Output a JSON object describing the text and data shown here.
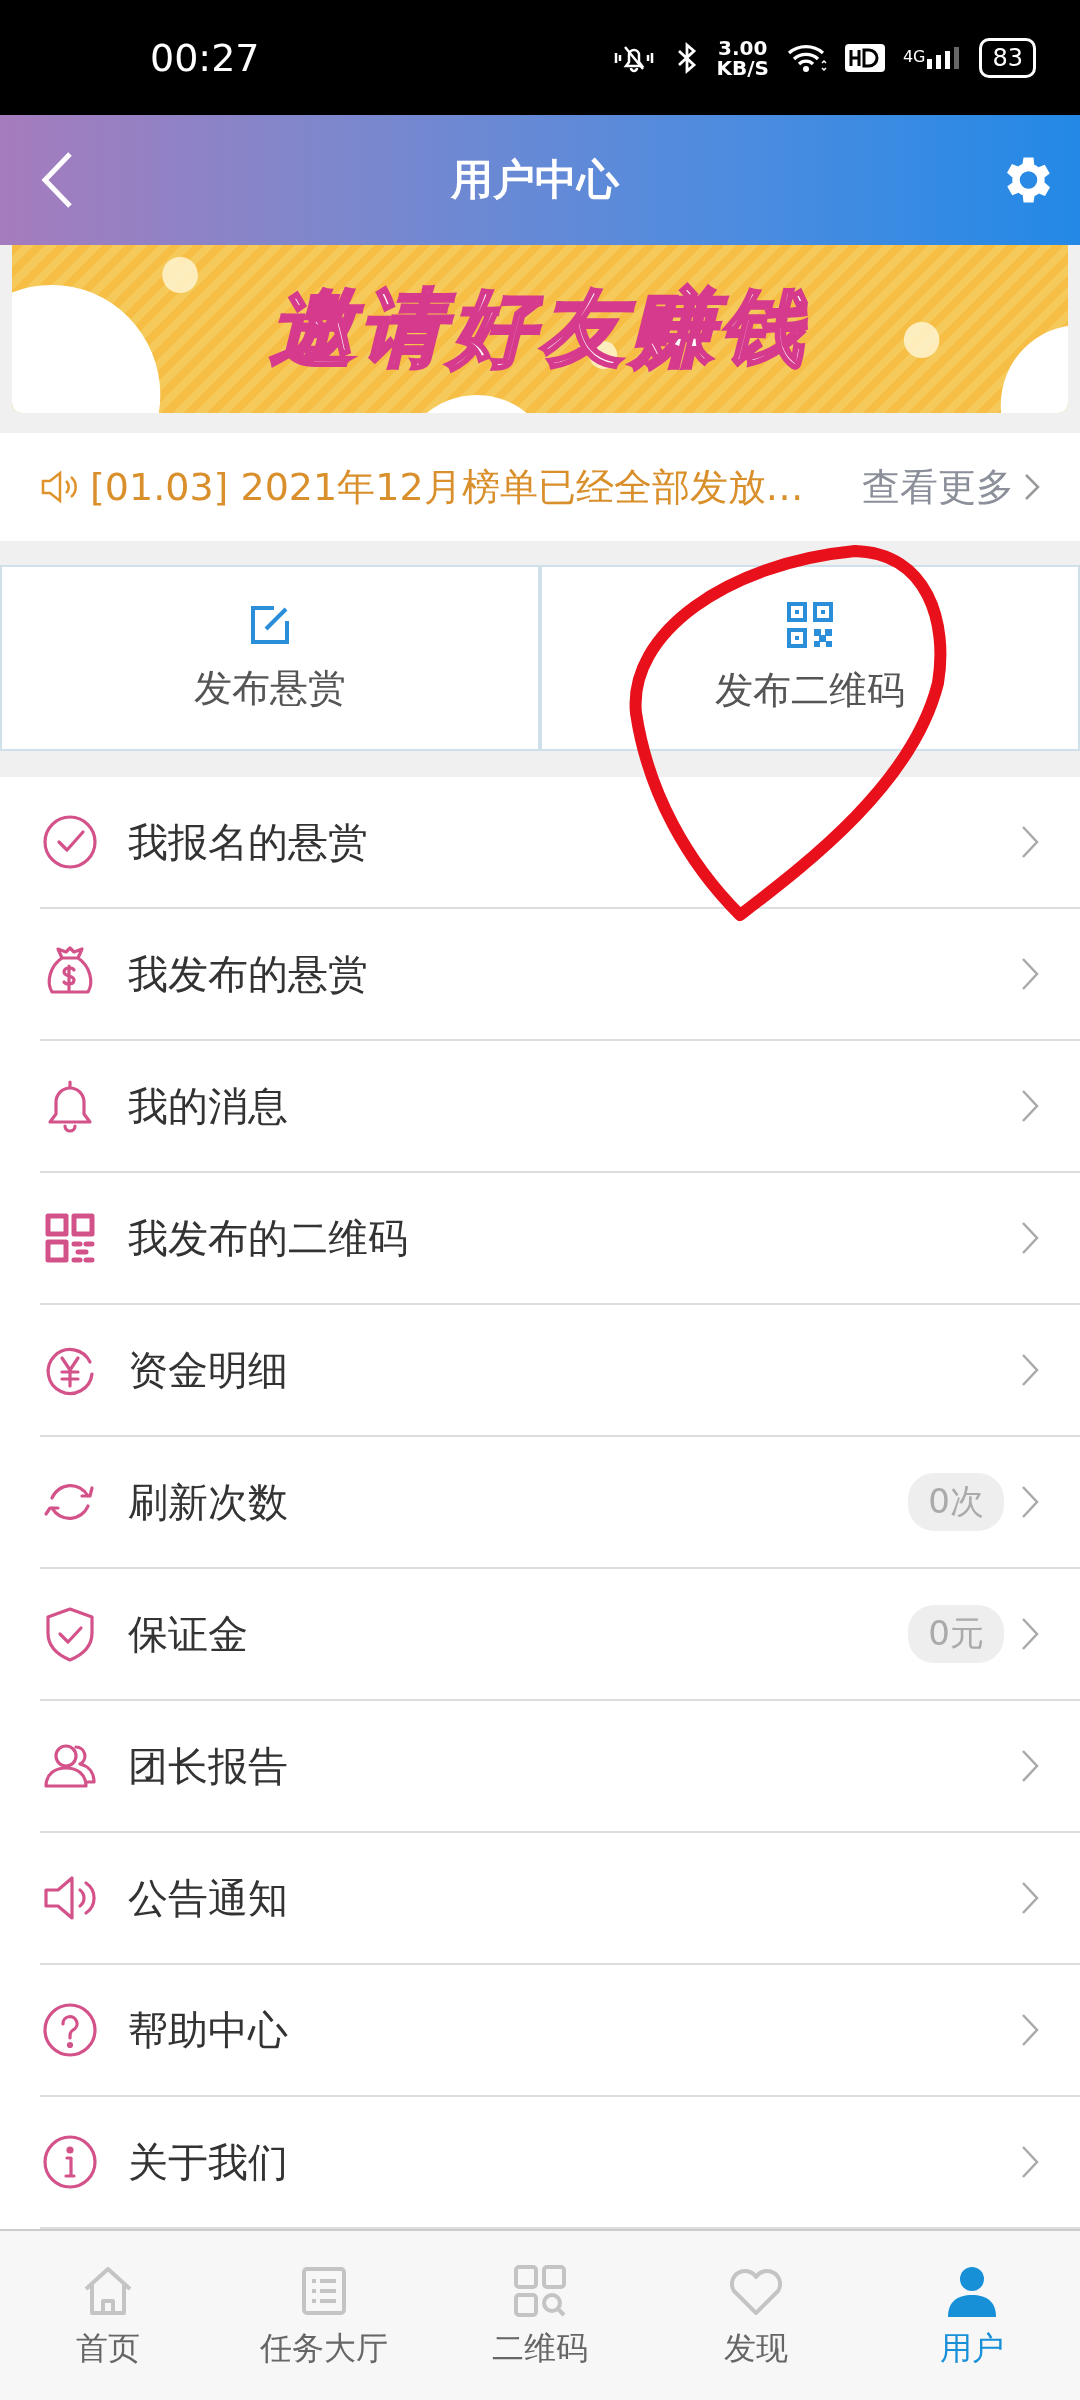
{
  "status_bar": {
    "time": "00:27",
    "speed_value": "3.00",
    "speed_unit": "KB/S",
    "network": "4G",
    "battery": "83"
  },
  "header": {
    "title": "用户中心"
  },
  "banner": {
    "title": "邀请好友赚钱"
  },
  "notice": {
    "text": "[01.03] 2021年12月榜单已经全部发放…",
    "more": "查看更多"
  },
  "actions": [
    {
      "label": "发布悬赏"
    },
    {
      "label": "发布二维码"
    }
  ],
  "menu": [
    {
      "label": "我报名的悬赏"
    },
    {
      "label": "我发布的悬赏"
    },
    {
      "label": "我的消息"
    },
    {
      "label": "我发布的二维码"
    },
    {
      "label": "资金明细"
    },
    {
      "label": "刷新次数",
      "badge": "0次"
    },
    {
      "label": "保证金",
      "badge": "0元"
    },
    {
      "label": "团长报告"
    },
    {
      "label": "公告通知"
    },
    {
      "label": "帮助中心"
    },
    {
      "label": "关于我们"
    }
  ],
  "tab_bar": [
    {
      "label": "首页",
      "selected": false
    },
    {
      "label": "任务大厅",
      "selected": false
    },
    {
      "label": "二维码",
      "selected": false
    },
    {
      "label": "发现",
      "selected": false
    },
    {
      "label": "用户",
      "selected": true
    }
  ]
}
